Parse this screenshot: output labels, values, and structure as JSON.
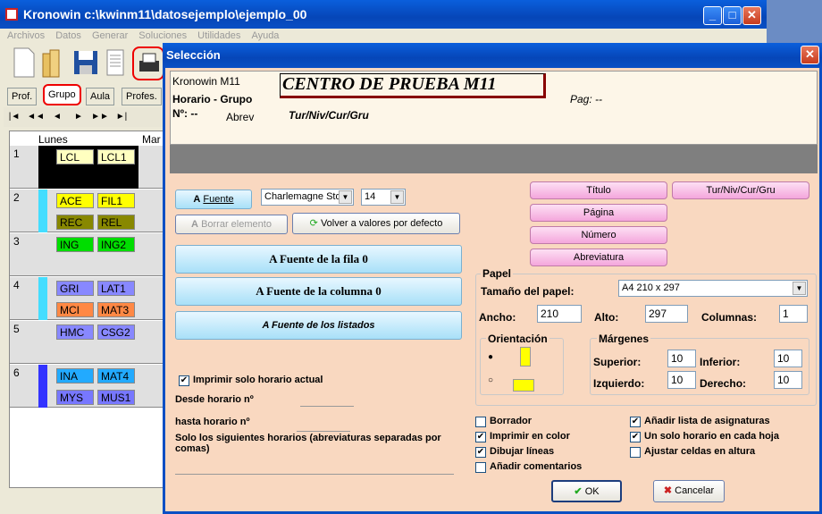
{
  "main": {
    "title": "Kronowin   c:\\kwinm11\\datosejemplo\\ejemplo_00",
    "menu": [
      "Archivos",
      "Datos",
      "Generar",
      "Soluciones",
      "Utilidades",
      "Ayuda"
    ],
    "tabs": [
      "Prof.",
      "Grupo",
      "Aula",
      "Profes."
    ],
    "nav": [
      "|◄",
      "◄◄",
      "◄",
      "►",
      "►►",
      "►|"
    ],
    "grid": {
      "col1": "Lunes",
      "col2": "Mar",
      "rows": [
        {
          "n": "1",
          "cells": [
            [
              "LCL",
              "#ffffc0"
            ],
            [
              "LCL1",
              "#ffffc0"
            ]
          ],
          "bar": "#000"
        },
        {
          "n": "2",
          "cells": [
            [
              "ACE",
              "#ffff00"
            ],
            [
              "FIL1",
              "#ffff00"
            ],
            [
              "REC",
              "#888800"
            ],
            [
              "REL",
              "#888800"
            ]
          ],
          "bar": "#44ddff"
        },
        {
          "n": "3",
          "cells": [
            [
              "ING",
              "#00dd00"
            ],
            [
              "ING2",
              "#00dd00"
            ]
          ],
          "bar": ""
        },
        {
          "n": "4",
          "cells": [
            [
              "GRI",
              "#8888ff"
            ],
            [
              "LAT1",
              "#8888ff"
            ],
            [
              "MCI",
              "#ff8844"
            ],
            [
              "MAT3",
              "#ff8844"
            ]
          ],
          "bar": "#44ddff"
        },
        {
          "n": "5",
          "cells": [
            [
              "HMC",
              "#8888ff"
            ],
            [
              "CSG2",
              "#8888ff"
            ]
          ],
          "bar": ""
        },
        {
          "n": "6",
          "cells": [
            [
              "INA",
              "#22aaff"
            ],
            [
              "MAT4",
              "#22aaff"
            ],
            [
              "MYS",
              "#7777ff"
            ],
            [
              "MUS1",
              "#7777ff"
            ]
          ],
          "bar": "#3333ff"
        }
      ]
    }
  },
  "dialog": {
    "title": "Selección",
    "preview": {
      "l1": "Kronowin M11",
      "l2": "Horario - Grupo",
      "l3": "Nº: --",
      "l3b": "Abrev",
      "center": "CENTRO DE PRUEBA M11",
      "tur": "Tur/Niv/Cur/Gru",
      "pag": "Pag: --"
    },
    "fuente": "Fuente",
    "font_name": "Charlemagne Std",
    "font_size": "14",
    "borrar": "Borrar elemento",
    "volver": "Volver a valores por defecto",
    "fila": "Fuente de la fila 0",
    "columna": "Fuente de la columna 0",
    "listados": "Fuente de los listados",
    "pink": [
      "Título",
      "Tur/Niv/Cur/Gru",
      "Página",
      "Número",
      "Abreviatura"
    ],
    "papel": {
      "legend": "Papel",
      "tamano_lbl": "Tamaño del papel:",
      "tamano": "A4 210 x 297",
      "ancho_lbl": "Ancho:",
      "ancho": "210",
      "alto_lbl": "Alto:",
      "alto": "297",
      "col_lbl": "Columnas:",
      "col": "1",
      "orient": "Orientación",
      "margenes": "Márgenes",
      "sup_lbl": "Superior:",
      "sup": "10",
      "inf_lbl": "Inferior:",
      "inf": "10",
      "izq_lbl": "Izquierdo:",
      "izq": "10",
      "der_lbl": "Derecho:",
      "der": "10"
    },
    "imprimir_actual": "Imprimir solo horario actual",
    "desde": "Desde horario nº",
    "hasta": "hasta horario nº",
    "solo": "Solo los siguientes horarios (abreviaturas separadas por comas)",
    "checks": [
      [
        "Borrador",
        false
      ],
      [
        "Imprimir en color",
        true
      ],
      [
        "Dibujar líneas",
        true
      ],
      [
        "Añadir comentarios",
        false
      ]
    ],
    "checks2": [
      [
        "Añadir lista de asignaturas",
        true
      ],
      [
        "Un solo horario en cada hoja",
        true
      ],
      [
        "Ajustar celdas en altura",
        false
      ]
    ],
    "ok": "OK",
    "cancel": "Cancelar"
  }
}
